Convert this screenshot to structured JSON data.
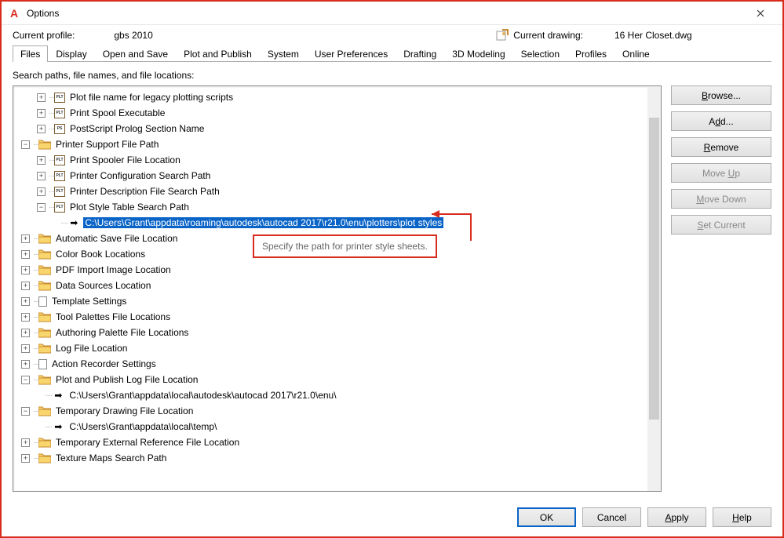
{
  "window": {
    "title": "Options"
  },
  "profile": {
    "label": "Current profile:",
    "value": "gbs 2010",
    "drawing_label": "Current drawing:",
    "drawing_value": "16 Her Closet.dwg"
  },
  "tabs": [
    "Files",
    "Display",
    "Open and Save",
    "Plot and Publish",
    "System",
    "User Preferences",
    "Drafting",
    "3D Modeling",
    "Selection",
    "Profiles",
    "Online"
  ],
  "section_label": "Search paths, file names, and file locations:",
  "tree": {
    "n0": "Plot file name for legacy plotting scripts",
    "n1": "Print Spool Executable",
    "n2": "PostScript Prolog Section Name",
    "n3": "Printer Support File Path",
    "n4": "Print Spooler File Location",
    "n5": "Printer Configuration Search Path",
    "n6": "Printer Description File Search Path",
    "n7": "Plot Style Table Search Path",
    "n8": "C:\\Users\\Grant\\appdata\\roaming\\autodesk\\autocad 2017\\r21.0\\enu\\plotters\\plot styles",
    "n9": "Automatic Save File Location",
    "n10": "Color Book Locations",
    "n11": "PDF Import Image Location",
    "n12": "Data Sources Location",
    "n13": "Template Settings",
    "n14": "Tool Palettes File Locations",
    "n15": "Authoring Palette File Locations",
    "n16": "Log File Location",
    "n17": "Action Recorder Settings",
    "n18": "Plot and Publish Log File Location",
    "n19": "C:\\Users\\Grant\\appdata\\local\\autodesk\\autocad 2017\\r21.0\\enu\\",
    "n20": "Temporary Drawing File Location",
    "n21": "C:\\Users\\Grant\\appdata\\local\\temp\\",
    "n22": "Temporary External Reference File Location",
    "n23": "Texture Maps Search Path"
  },
  "side": {
    "browse": "Browse...",
    "add": "Add...",
    "remove": "Remove",
    "moveup": "Move Up",
    "movedown": "Move Down",
    "setcurrent": "Set Current"
  },
  "bottom": {
    "ok": "OK",
    "cancel": "Cancel",
    "apply": "Apply",
    "help": "Help"
  },
  "annotation": "Specify the path for printer style sheets."
}
